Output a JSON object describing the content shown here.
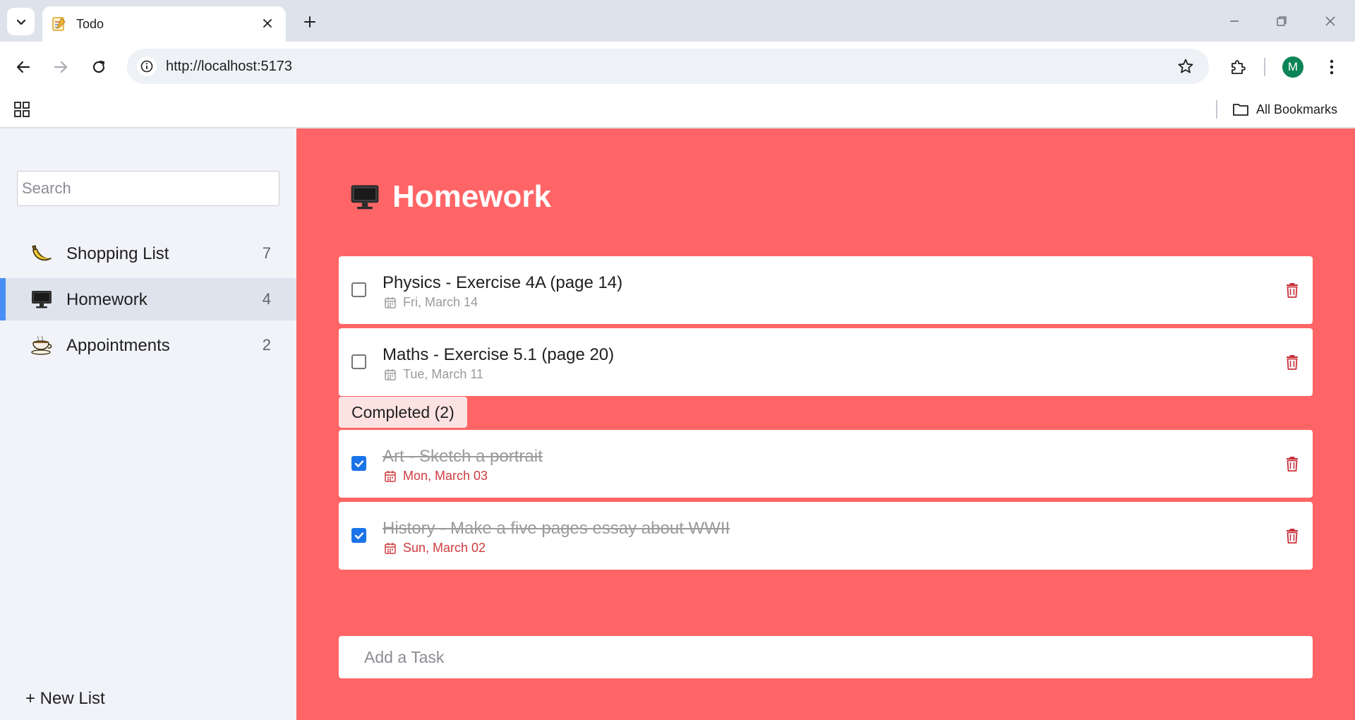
{
  "browser": {
    "tab_title": "Todo",
    "url": "http://localhost:5173",
    "avatar_letter": "M",
    "bookmarks_label": "All Bookmarks"
  },
  "sidebar": {
    "search_placeholder": "Search",
    "lists": [
      {
        "label": "Shopping List",
        "count": "7",
        "icon": "banana-icon",
        "active": false
      },
      {
        "label": "Homework",
        "count": "4",
        "icon": "computer-monitor-icon",
        "active": true
      },
      {
        "label": "Appointments",
        "count": "2",
        "icon": "coffee-cup-icon",
        "active": false
      }
    ],
    "new_list_label": "+ New List"
  },
  "main": {
    "title": "Homework",
    "title_icon": "computer-monitor-icon",
    "background_color": "#ff6566",
    "tasks": [
      {
        "title": "Physics - Exercise 4A (page 14)",
        "due": "Fri, March 14",
        "completed": false
      },
      {
        "title": "Maths - Exercise 5.1 (page 20)",
        "due": "Tue, March 11",
        "completed": false
      }
    ],
    "completed_label": "Completed (2)",
    "completed_tasks": [
      {
        "title": "Art - Sketch a portrait",
        "due": "Mon, March 03",
        "completed": true
      },
      {
        "title": "History - Make a five pages essay about WWII",
        "due": "Sun, March 02",
        "completed": true
      }
    ],
    "add_task_placeholder": "Add a Task"
  },
  "colors": {
    "accent_blue": "#4a8ff5",
    "overdue_red": "#cf3b3f",
    "trash_red": "#c8303a"
  }
}
